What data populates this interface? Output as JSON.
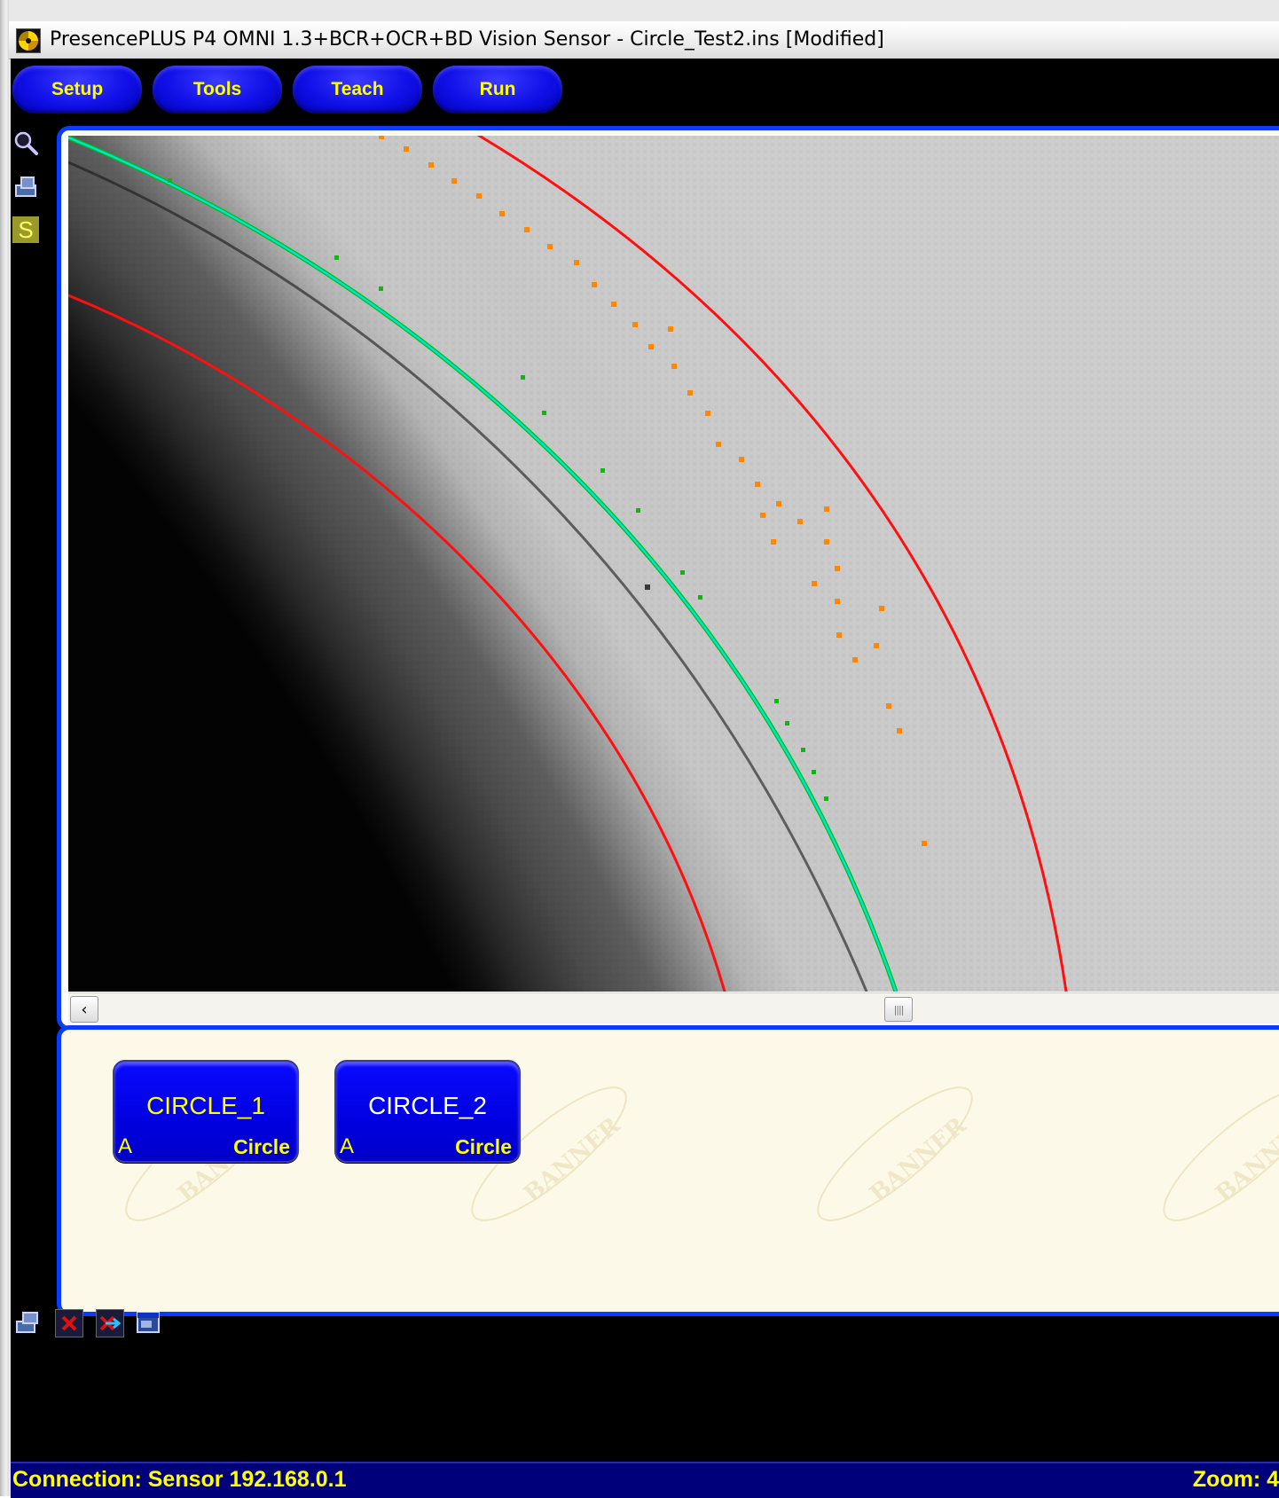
{
  "window": {
    "title": "PresencePLUS  P4 OMNI 1.3+BCR+OCR+BD Vision Sensor - Circle_Test2.ins [Modified]"
  },
  "nav": {
    "setup_label": "Setup",
    "tools_label": "Tools",
    "teach_label": "Teach",
    "run_label": "Run"
  },
  "side_toolbar": [
    "zoom-icon",
    "inspection-icon",
    "s-icon"
  ],
  "side_s_glyph": "S",
  "tools_panel": {
    "tools": [
      {
        "name": "CIRCLE_1",
        "slot": "A",
        "type": "Circle",
        "name_color": "#ffff00"
      },
      {
        "name": "CIRCLE_2",
        "slot": "A",
        "type": "Circle",
        "name_color": "#ffffff"
      }
    ],
    "watermark_text": "BANNER"
  },
  "bottom_toolbar": [
    "properties-icon",
    "delete-icon",
    "swap-icon",
    "window-icon"
  ],
  "scrollbar": {
    "left_arrow": "‹",
    "thumb_grip": "||||"
  },
  "status": {
    "connection": "Connection: Sensor 192.168.0.1",
    "zoom": "Zoom: 4"
  },
  "colors": {
    "accent_blue": "#0a3cff",
    "button_text": "#ffff00",
    "search_region": "#ff1010",
    "fitted_circle": "#00e0e0",
    "edge_points_found": "#00c000",
    "edge_points_rejected": "#ff8800",
    "status_bg": "#00007a"
  }
}
